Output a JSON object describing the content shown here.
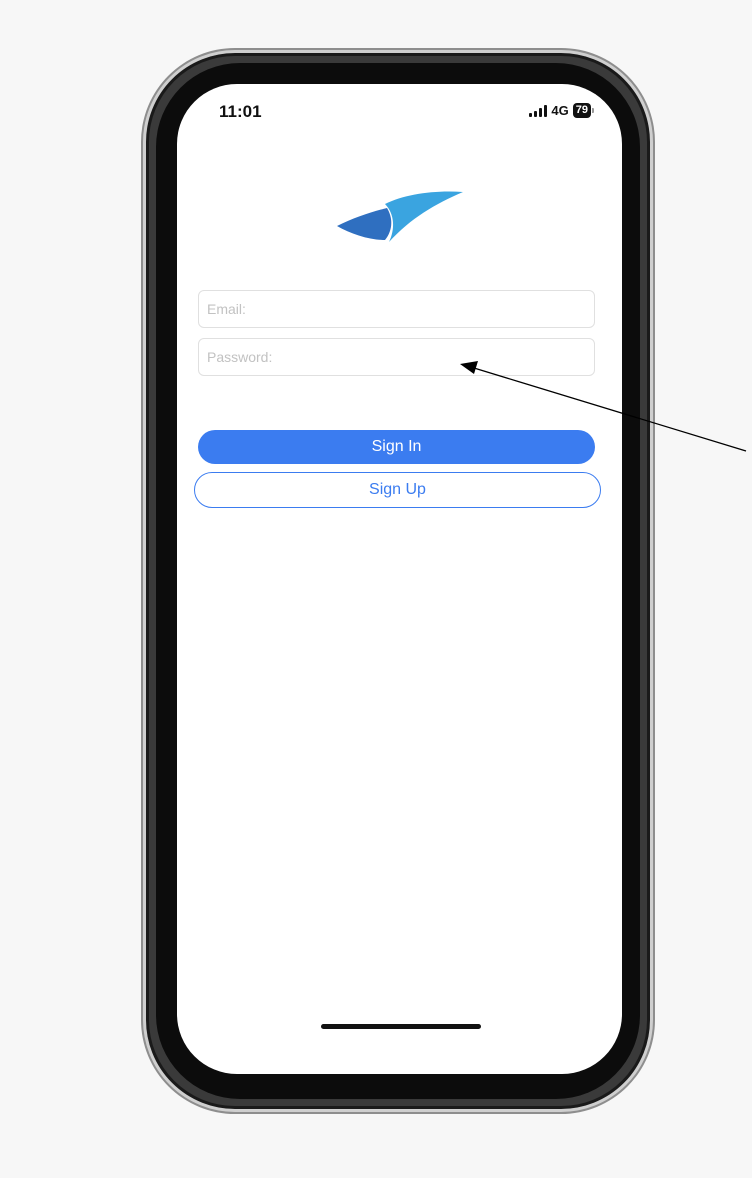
{
  "status_bar": {
    "time": "11:01",
    "network": "4G",
    "battery": "79"
  },
  "form": {
    "email_placeholder": "Email:",
    "password_placeholder": "Password:"
  },
  "buttons": {
    "sign_in": "Sign In",
    "sign_up": "Sign Up"
  },
  "colors": {
    "accent": "#3b7cf0",
    "logo_light": "#3aa4e0",
    "logo_dark": "#2f6fc0"
  },
  "icons": {
    "logo": "paper-plane-wing-logo",
    "signal": "cellular-signal-icon",
    "battery": "battery-icon",
    "annotation": "annotation-arrow"
  }
}
